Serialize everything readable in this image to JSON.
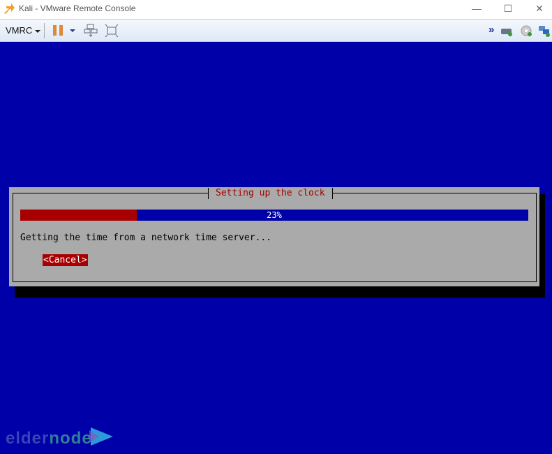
{
  "window": {
    "title": "Kali - VMware Remote Console",
    "controls": {
      "minimize": "—",
      "maximize": "☐",
      "close": "✕"
    }
  },
  "toolbar": {
    "menu_label": "VMRC",
    "icons": [
      "pause-icon",
      "pause-dropdown-icon",
      "send-ctrl-alt-del-icon",
      "fullscreen-icon"
    ],
    "right_icons": [
      "more-chevrons-icon",
      "hard-disk-icon",
      "cd-dvd-icon",
      "network-adapter-icon"
    ],
    "more": "»"
  },
  "dialog": {
    "title": "Setting up the clock",
    "progress": {
      "percent": 23,
      "label": "23%"
    },
    "message": "Getting the time from a network time server...",
    "cancel_label": "<Cancel>"
  },
  "watermark": {
    "part1": "elder",
    "part2": "node"
  },
  "colors": {
    "background": "#0000a8",
    "dialog": "#aaaaaa",
    "accent_red": "#a80000"
  }
}
